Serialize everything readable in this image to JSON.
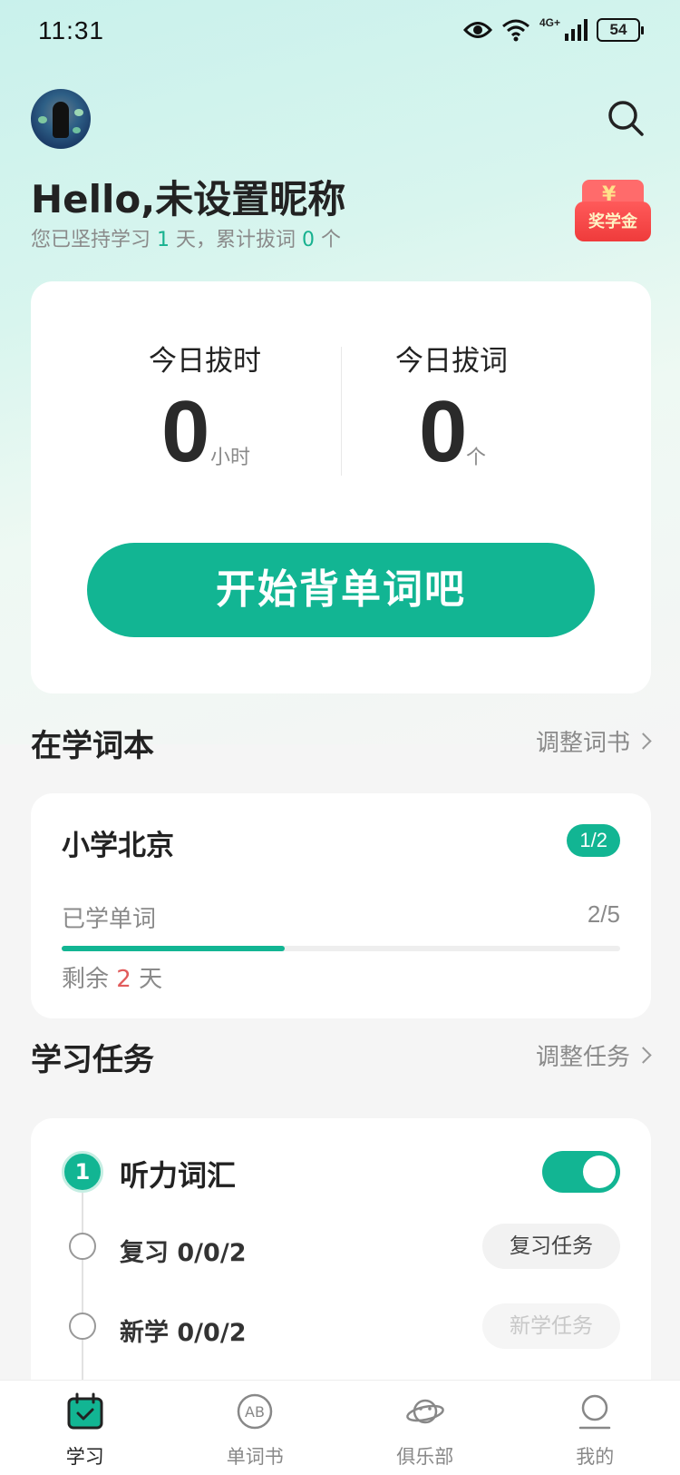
{
  "status": {
    "time": "11:31",
    "battery": "54",
    "network": "4G+"
  },
  "profile": {
    "greeting": "Hello,未设置昵称",
    "streak_prefix": "您已坚持学习 ",
    "streak_days": "1",
    "streak_mid": " 天，累计拔词 ",
    "words_total": "0",
    "streak_suffix": " 个",
    "scholarship_label": "奖学金",
    "scholarship_symbol": "¥"
  },
  "today": {
    "time_label": "今日拔时",
    "time_value": "0",
    "time_unit": "小时",
    "words_label": "今日拔词",
    "words_value": "0",
    "words_unit": "个",
    "start_button": "开始背单词吧"
  },
  "studying_book": {
    "section_title": "在学词本",
    "adjust_link": "调整词书",
    "book_name": "小学北京",
    "badge": "1/2",
    "learned_label": "已学单词",
    "learned_count": "2/5",
    "progress": 0.4,
    "remain_prefix": "剩余 ",
    "remain_days": "2",
    "remain_suffix": " 天"
  },
  "tasks": {
    "section_title": "学习任务",
    "adjust_link": "调整任务",
    "step_number": "1",
    "task_name": "听力词汇",
    "toggle_on": true,
    "review_label": "复习 0/0/2",
    "review_button": "复习任务",
    "new_label": "新学 0/0/2",
    "new_button": "新学任务"
  },
  "tabs": [
    {
      "label": "学习",
      "icon": "calendar-check-icon",
      "active": true
    },
    {
      "label": "单词书",
      "icon": "ab-circle-icon",
      "active": false
    },
    {
      "label": "俱乐部",
      "icon": "planet-icon",
      "active": false
    },
    {
      "label": "我的",
      "icon": "person-icon",
      "active": false
    }
  ],
  "colors": {
    "accent": "#12b593",
    "highlight_red": "#e15b5b"
  }
}
